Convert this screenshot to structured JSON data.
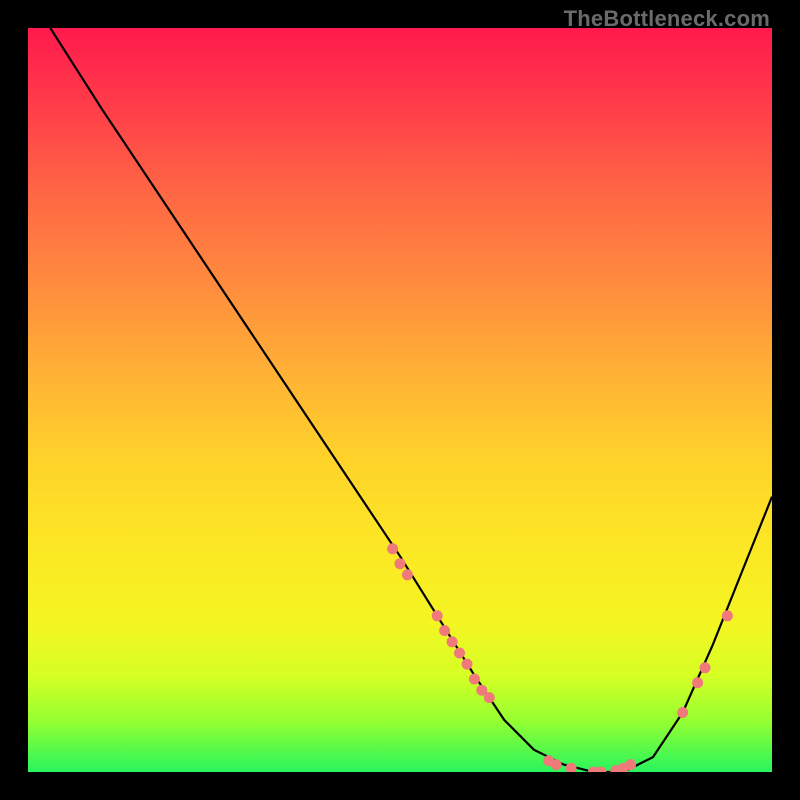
{
  "watermark": "TheBottleneck.com",
  "colors": {
    "background": "#000000",
    "curve": "#000000",
    "point": "#f07a7a",
    "gradient_top": "#ff1a4d",
    "gradient_bottom": "#28f55e"
  },
  "chart_data": {
    "type": "line",
    "title": "",
    "xlabel": "",
    "ylabel": "",
    "xlim": [
      0,
      100
    ],
    "ylim": [
      0,
      100
    ],
    "series": [
      {
        "name": "curve",
        "x": [
          3,
          10,
          20,
          30,
          40,
          50,
          55,
          60,
          64,
          68,
          72,
          76,
          80,
          84,
          88,
          92,
          96,
          100
        ],
        "y": [
          100,
          89,
          74,
          59,
          44,
          29,
          21,
          13,
          7,
          3,
          1,
          0,
          0,
          2,
          8,
          17,
          27,
          37
        ]
      }
    ],
    "scatter_points": [
      {
        "x": 49,
        "y": 30
      },
      {
        "x": 50,
        "y": 28
      },
      {
        "x": 51,
        "y": 26.5
      },
      {
        "x": 55,
        "y": 21
      },
      {
        "x": 56,
        "y": 19
      },
      {
        "x": 57,
        "y": 17.5
      },
      {
        "x": 58,
        "y": 16
      },
      {
        "x": 59,
        "y": 14.5
      },
      {
        "x": 60,
        "y": 12.5
      },
      {
        "x": 61,
        "y": 11
      },
      {
        "x": 62,
        "y": 10
      },
      {
        "x": 70,
        "y": 1.5
      },
      {
        "x": 71,
        "y": 1
      },
      {
        "x": 73,
        "y": 0.5
      },
      {
        "x": 76,
        "y": 0
      },
      {
        "x": 77,
        "y": 0
      },
      {
        "x": 79,
        "y": 0.2
      },
      {
        "x": 80,
        "y": 0.5
      },
      {
        "x": 81,
        "y": 1
      },
      {
        "x": 88,
        "y": 8
      },
      {
        "x": 90,
        "y": 12
      },
      {
        "x": 91,
        "y": 14
      },
      {
        "x": 94,
        "y": 21
      }
    ]
  }
}
